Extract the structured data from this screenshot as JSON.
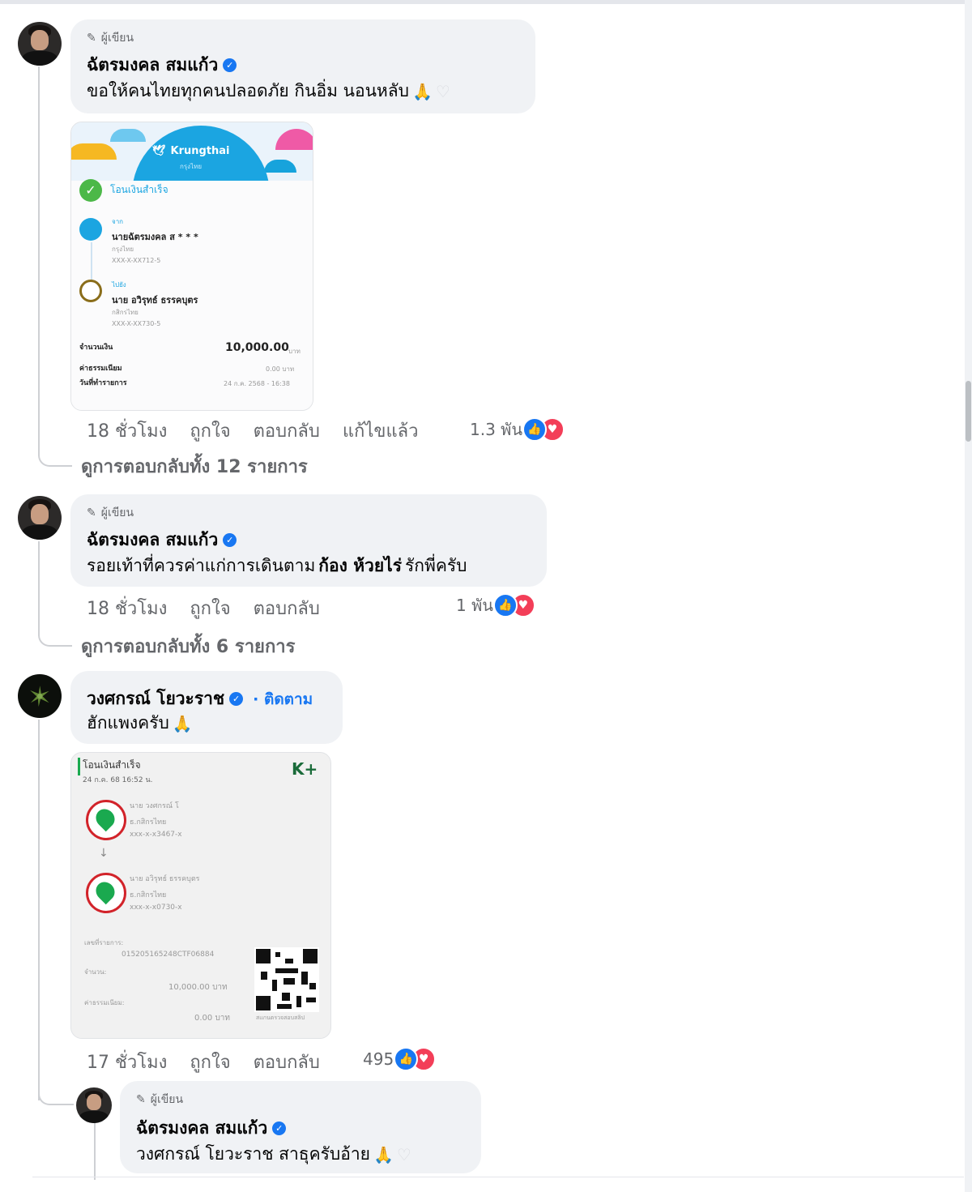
{
  "colors": {
    "bubble": "#f0f2f5",
    "link": "#1877f2",
    "muted": "#65676b",
    "like": "#1877f2",
    "love": "#f33e58"
  },
  "comments": [
    {
      "author_badge": "ผู้เขียน",
      "name": "ฉัตรมงคล สมแก้ว",
      "text": "ขอให้คนไทยทุกคนปลอดภัย กินอิ่ม นอนหลับ",
      "emoji": "🙏",
      "time": "18 ชั่วโมง",
      "like": "ถูกใจ",
      "reply": "ตอบกลับ",
      "edited": "แก้ไขแล้ว",
      "reactions": "1.3 พัน",
      "view_replies": "ดูการตอบกลับทั้ง 12 รายการ",
      "receipt": {
        "bank": "Krungthai",
        "bank_th": "กรุงไทย",
        "status": "โอนเงินสำเร็จ",
        "from_label": "จาก",
        "from_name": "นายฉัตรมงคล ส * * *",
        "from_bank": "กรุงไทย",
        "from_acct": "XXX-X-XX712-5",
        "to_label": "ไปยัง",
        "to_name": "นาย อวิรุทธ์ ธรรคบุตร",
        "to_bank": "กสิกรไทย",
        "to_acct": "XXX-X-XX730-5",
        "amount_label": "จำนวนเงิน",
        "amount": "10,000.00",
        "amount_unit": "บาท",
        "fee_label": "ค่าธรรมเนียม",
        "fee": "0.00 บาท",
        "date_label": "วันที่ทำรายการ",
        "date": "24 ก.ค. 2568 - 16:38"
      }
    },
    {
      "author_badge": "ผู้เขียน",
      "name": "ฉัตรมงคล สมแก้ว",
      "text": "รอยเท้าที่ควรค่าแก่การเดินตาม",
      "text_bold": "ก้อง ห้วยไร่",
      "text_tail": "รักพี่ครับ",
      "time": "18 ชั่วโมง",
      "like": "ถูกใจ",
      "reply": "ตอบกลับ",
      "reactions": "1 พัน",
      "view_replies": "ดูการตอบกลับทั้ง 6 รายการ"
    },
    {
      "name": "วงศกรณ์ โยวะราช",
      "follow": "· ติดตาม",
      "text": "ฮักแพงครับ",
      "emoji": "🙏",
      "time": "17 ชั่วโมง",
      "like": "ถูกใจ",
      "reply": "ตอบกลับ",
      "reactions": "495",
      "receipt": {
        "status": "โอนเงินสำเร็จ",
        "date": "24 ก.ค. 68  16:52 น.",
        "brand": "K+",
        "from_name": "นาย วงศกรณ์ โ",
        "from_bank": "ธ.กสิกรไทย",
        "from_acct": "xxx-x-x3467-x",
        "to_name": "นาย อวิรุทธ์ ธรรคบุตร",
        "to_bank": "ธ.กสิกรไทย",
        "to_acct": "xxx-x-x0730-x",
        "ref_label": "เลขที่รายการ:",
        "ref": "015205165248CTF06884",
        "amount_label": "จำนวน:",
        "amount": "10,000.00 บาท",
        "fee_label": "ค่าธรรมเนียม:",
        "fee": "0.00 บาท",
        "qr_caption": "สแกนตรวจสอบสลิป"
      }
    }
  ],
  "reply": {
    "author_badge": "ผู้เขียน",
    "name": "ฉัตรมงคล สมแก้ว",
    "text": "วงศกรณ์ โยวะราช สาธุครับอ้าย",
    "emoji": "🙏"
  }
}
